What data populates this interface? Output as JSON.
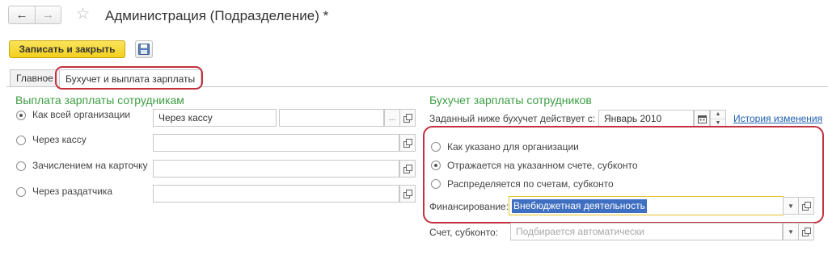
{
  "window": {
    "title": "Администрация (Подразделение) *",
    "back_symbol": "←",
    "forward_symbol": "→",
    "favorite_symbol": "☆"
  },
  "toolbar": {
    "save_close_label": "Записать и закрыть",
    "save_icon": "floppy-disk-icon"
  },
  "tabs": [
    {
      "label": "Главное",
      "active": false
    },
    {
      "label": "Бухучет и выплата зарплаты",
      "active": true
    }
  ],
  "left_group": {
    "title": "Выплата зарплаты сотрудникам",
    "options": [
      {
        "label": "Как всей организации",
        "checked": true
      },
      {
        "label": "Через кассу",
        "checked": false
      },
      {
        "label": "Зачислением на карточку",
        "checked": false
      },
      {
        "label": "Через раздатчика",
        "checked": false
      }
    ],
    "method_value": "Через кассу",
    "choose_symbol": "..."
  },
  "right_group": {
    "title": "Бухучет зарплаты сотрудников",
    "effective_label": "Заданный ниже бухучет действует с:",
    "effective_value": "Январь 2010",
    "history_link": "История изменения",
    "options": [
      {
        "label": "Как указано для организации",
        "checked": false
      },
      {
        "label": "Отражается на указанном счете, субконто",
        "checked": true
      },
      {
        "label": "Распределяется по счетам, субконто",
        "checked": false
      }
    ],
    "financing_label": "Финансирование:",
    "financing_value": "Внебюджетная деятельность",
    "account_label": "Счет, субконто:",
    "account_placeholder": "Подбирается автоматически"
  },
  "colors": {
    "accent_green": "#3c9e43",
    "highlight_red": "#c3303e",
    "primary_button": "#f2cf1e",
    "selection": "#3f6fc0",
    "link": "#1f5fb0"
  }
}
